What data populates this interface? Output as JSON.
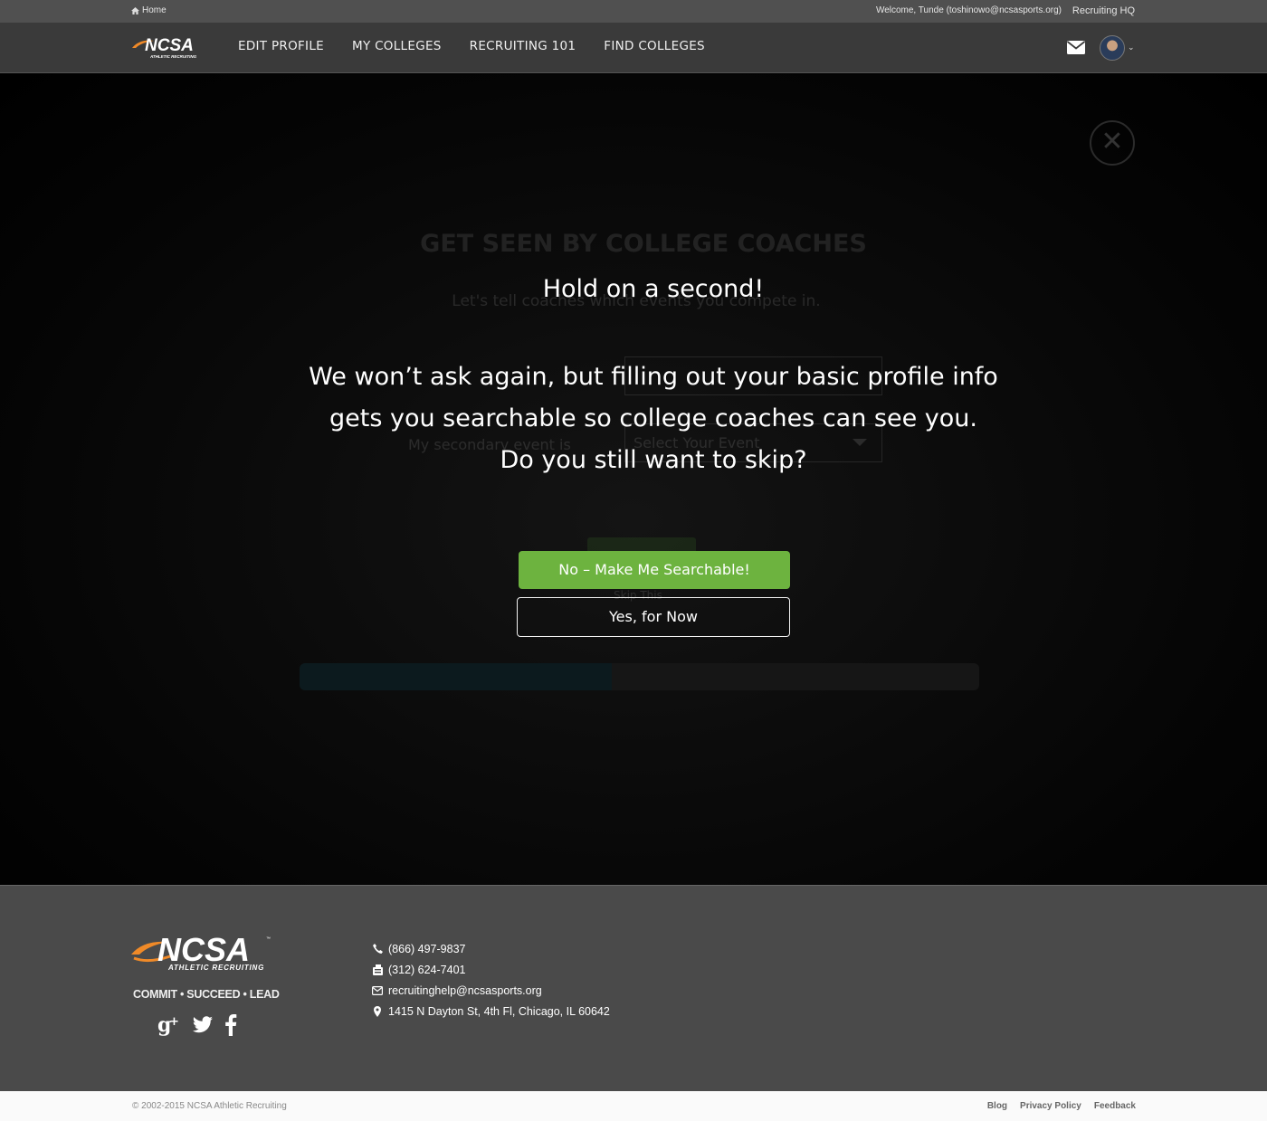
{
  "topbar": {
    "home_label": "Home",
    "welcome_text": "Welcome, Tunde (toshinowo@ncsasports.org)",
    "hq_link": "Recruiting HQ"
  },
  "brand": {
    "logo_text": "NCSA",
    "logo_sub": "ATHLETIC RECRUITING",
    "accent": "#f08a28"
  },
  "nav": {
    "items": [
      {
        "label": "EDIT PROFILE"
      },
      {
        "label": "MY COLLEGES"
      },
      {
        "label": "RECRUITING 101"
      },
      {
        "label": "FIND COLLEGES"
      }
    ],
    "mail_icon": "envelope-icon",
    "avatar_icon": "user-avatar"
  },
  "background_form": {
    "title": "GET SEEN BY COLLEGE COACHES",
    "subtitle": "Let's tell coaches which events you compete in.",
    "secondary_label": "My secondary event is",
    "select_placeholder": "Select Your Event",
    "skip_label": "Skip This",
    "progress": 0.46
  },
  "modal": {
    "close_icon": "close-icon",
    "title": "Hold on a second!",
    "line1": "We won’t ask again, but filling out your basic profile info",
    "line2": "gets you searchable so college coaches can see you.",
    "line3": "Do you still want to skip?",
    "primary_button": "No – Make Me Searchable!",
    "secondary_button": "Yes, for Now",
    "primary_color": "#6db33f"
  },
  "footer": {
    "logo_text": "NCSA",
    "logo_sub": "ATHLETIC RECRUITING",
    "tagline": "COMMIT • SUCCEED • LEAD",
    "social": [
      "google-plus-icon",
      "twitter-icon",
      "facebook-icon"
    ],
    "phone": "(866) 497-9837",
    "fax": "(312) 624-7401",
    "email": "recruitinghelp@ncsasports.org",
    "address": "1415 N Dayton St, 4th Fl, Chicago, IL 60642"
  },
  "bottombar": {
    "copyright": "© 2002-2015 NCSA Athletic Recruiting",
    "links": [
      "Blog",
      "Privacy Policy",
      "Feedback"
    ]
  }
}
